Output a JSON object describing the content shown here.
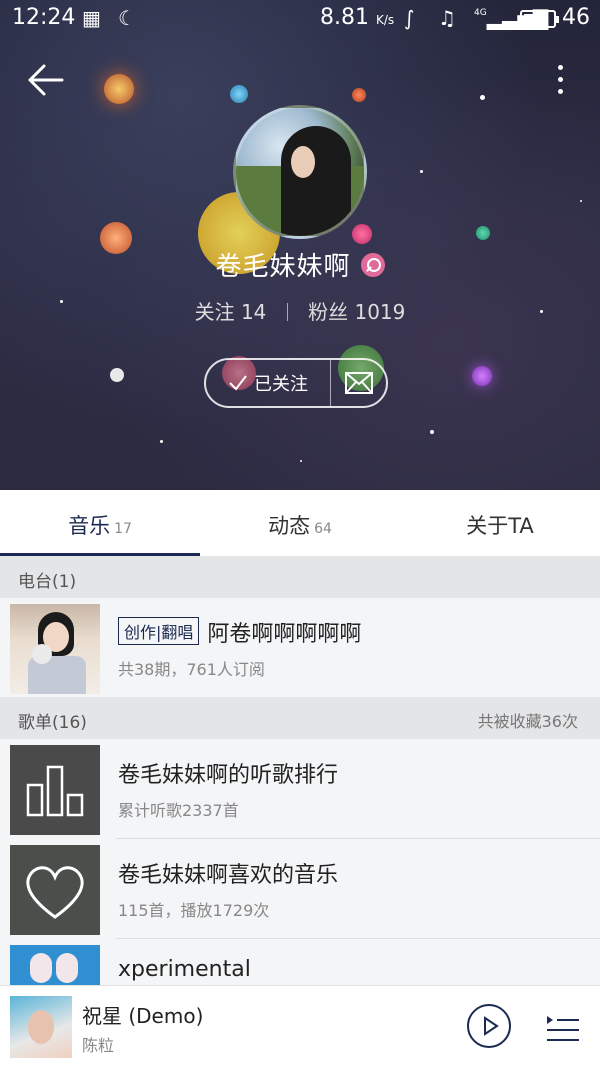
{
  "status_bar": {
    "time": "12:24",
    "speed": "8.81",
    "speed_unit": "K/s",
    "network": "4G",
    "battery": "46"
  },
  "profile": {
    "username": "卷毛妹妹啊",
    "following_label": "关注 14",
    "fans_label": "粉丝 1019",
    "followed_label": "已关注"
  },
  "tabs": [
    {
      "label": "音乐",
      "count": "17"
    },
    {
      "label": "动态",
      "count": "64"
    },
    {
      "label": "关于TA",
      "count": ""
    }
  ],
  "radio_section": {
    "header": "电台(1)",
    "item": {
      "tag": "创作|翻唱",
      "title": "阿卷啊啊啊啊啊",
      "subtitle": "共38期，761人订阅"
    }
  },
  "playlist_section": {
    "header": "歌单(16)",
    "right_text": "共被收藏36次",
    "items": [
      {
        "title": "卷毛妹妹啊的听歌排行",
        "subtitle": "累计听歌2337首",
        "icon": "bar-chart-icon"
      },
      {
        "title": "卷毛妹妹啊喜欢的音乐",
        "subtitle": "115首，播放1729次",
        "icon": "heart-icon"
      },
      {
        "title": "xperimental",
        "subtitle": "",
        "icon": "cover-art"
      }
    ]
  },
  "player": {
    "title": "祝星 (Demo)",
    "artist": "陈粒"
  },
  "colors": {
    "accent": "#1c2a52",
    "header_bg": "#2a2a40"
  }
}
